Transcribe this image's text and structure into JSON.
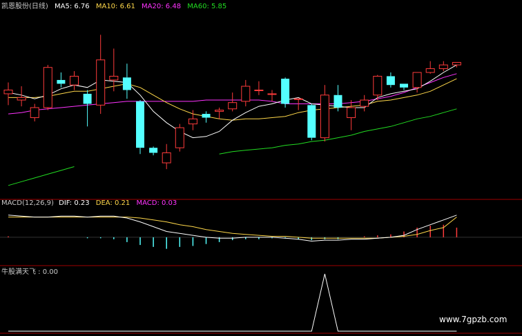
{
  "colors": {
    "up": "#ff3b3b",
    "down": "#54ffff",
    "ma5": "#ffffff",
    "ma10": "#ffd84a",
    "ma20": "#ff33ff",
    "ma60": "#22dd22",
    "dif": "#ffffff",
    "dea": "#ffd84a",
    "panel_border": "#a00000",
    "indicator": "#ffffff"
  },
  "header": {
    "stock_title": "凯恩股份(日线)",
    "ma5": "MA5: 6.76",
    "ma10": "MA10: 6.61",
    "ma20": "MA20: 6.48",
    "ma60": "MA60: 5.85"
  },
  "macd_header": {
    "title": "MACD(12,26,9)",
    "dif": "DIF: 0.23",
    "dea": "DEA: 0.21",
    "macd": "MACD: 0.03"
  },
  "indicator_header": {
    "label": "牛股满天飞 : 0.00"
  },
  "watermark": "www.7gpzb.com",
  "chart_data": [
    {
      "type": "candlestick",
      "candles": [
        {
          "o": 6.13,
          "h": 6.22,
          "l": 6.04,
          "c": 6.16
        },
        {
          "o": 6.08,
          "h": 6.19,
          "l": 6.03,
          "c": 6.1
        },
        {
          "o": 5.94,
          "h": 6.05,
          "l": 5.91,
          "c": 6.02
        },
        {
          "o": 6.02,
          "h": 6.36,
          "l": 6.0,
          "c": 6.34
        },
        {
          "o": 6.24,
          "h": 6.3,
          "l": 6.18,
          "c": 6.21
        },
        {
          "o": 6.2,
          "h": 6.31,
          "l": 6.16,
          "c": 6.27
        },
        {
          "o": 6.13,
          "h": 6.16,
          "l": 5.87,
          "c": 6.05
        },
        {
          "o": 6.04,
          "h": 6.6,
          "l": 5.97,
          "c": 6.4
        },
        {
          "o": 6.24,
          "h": 6.49,
          "l": 6.15,
          "c": 6.27
        },
        {
          "o": 6.26,
          "h": 6.37,
          "l": 6.09,
          "c": 6.16
        },
        {
          "o": 6.07,
          "h": 6.08,
          "l": 5.65,
          "c": 5.7
        },
        {
          "o": 5.7,
          "h": 5.71,
          "l": 5.64,
          "c": 5.66
        },
        {
          "o": 5.58,
          "h": 5.73,
          "l": 5.53,
          "c": 5.66
        },
        {
          "o": 5.7,
          "h": 5.89,
          "l": 5.67,
          "c": 5.86
        },
        {
          "o": 5.89,
          "h": 6.0,
          "l": 5.84,
          "c": 5.93
        },
        {
          "o": 5.97,
          "h": 5.99,
          "l": 5.9,
          "c": 5.94
        },
        {
          "o": 5.99,
          "h": 6.02,
          "l": 5.93,
          "c": 6.0
        },
        {
          "o": 6.01,
          "h": 6.14,
          "l": 5.99,
          "c": 6.06
        },
        {
          "o": 6.07,
          "h": 6.24,
          "l": 6.03,
          "c": 6.19
        },
        {
          "o": 6.16,
          "h": 6.23,
          "l": 6.12,
          "c": 6.16
        },
        {
          "o": 6.13,
          "h": 6.16,
          "l": 6.07,
          "c": 6.13
        },
        {
          "o": 6.25,
          "h": 6.26,
          "l": 6.02,
          "c": 6.05
        },
        {
          "o": 6.09,
          "h": 6.09,
          "l": 6.0,
          "c": 6.09
        },
        {
          "o": 6.04,
          "h": 6.05,
          "l": 5.76,
          "c": 5.78
        },
        {
          "o": 5.78,
          "h": 6.2,
          "l": 5.75,
          "c": 6.12
        },
        {
          "o": 6.12,
          "h": 6.2,
          "l": 5.99,
          "c": 6.02
        },
        {
          "o": 5.94,
          "h": 6.08,
          "l": 5.84,
          "c": 6.02
        },
        {
          "o": 6.03,
          "h": 6.12,
          "l": 5.99,
          "c": 6.08
        },
        {
          "o": 6.12,
          "h": 6.28,
          "l": 6.08,
          "c": 6.27
        },
        {
          "o": 6.27,
          "h": 6.3,
          "l": 6.18,
          "c": 6.2
        },
        {
          "o": 6.21,
          "h": 6.21,
          "l": 6.16,
          "c": 6.18
        },
        {
          "o": 6.18,
          "h": 6.3,
          "l": 6.14,
          "c": 6.3
        },
        {
          "o": 6.3,
          "h": 6.39,
          "l": 6.29,
          "c": 6.33
        },
        {
          "o": 6.33,
          "h": 6.39,
          "l": 6.31,
          "c": 6.36
        },
        {
          "o": 6.36,
          "h": 6.38,
          "l": 6.34,
          "c": 6.38
        }
      ],
      "ma5": [
        6.14,
        6.12,
        6.09,
        6.12,
        6.17,
        6.2,
        6.18,
        6.24,
        6.23,
        6.22,
        6.12,
        5.99,
        5.9,
        5.83,
        5.78,
        5.79,
        5.83,
        5.92,
        5.98,
        6.03,
        6.05,
        6.08,
        6.1,
        6.05,
        6.04,
        6.03,
        6.02,
        6.02,
        6.1,
        6.13,
        6.15,
        6.17,
        6.23,
        6.3,
        6.36
      ],
      "ma10": [
        6.1,
        6.1,
        6.1,
        6.11,
        6.13,
        6.15,
        6.15,
        6.17,
        6.19,
        6.21,
        6.18,
        6.12,
        6.06,
        6.01,
        5.97,
        5.95,
        5.93,
        5.92,
        5.93,
        5.93,
        5.94,
        5.95,
        5.98,
        6.0,
        6.01,
        6.02,
        6.03,
        6.04,
        6.07,
        6.08,
        6.1,
        6.12,
        6.15,
        6.2,
        6.25
      ],
      "ma20": [
        5.97,
        5.98,
        6.0,
        6.01,
        6.02,
        6.03,
        6.04,
        6.05,
        6.06,
        6.07,
        6.07,
        6.07,
        6.07,
        6.07,
        6.07,
        6.08,
        6.08,
        6.08,
        6.08,
        6.08,
        6.07,
        6.05,
        6.05,
        6.05,
        6.05,
        6.05,
        6.06,
        6.07,
        6.09,
        6.11,
        6.14,
        6.18,
        6.22,
        6.26,
        6.29
      ],
      "ma60": [
        5.4,
        5.43,
        5.46,
        5.49,
        5.52,
        5.55,
        null,
        null,
        null,
        null,
        null,
        null,
        null,
        null,
        null,
        null,
        5.65,
        5.67,
        5.68,
        5.69,
        5.7,
        5.72,
        5.73,
        5.75,
        5.76,
        5.78,
        5.8,
        5.83,
        5.85,
        5.87,
        5.9,
        5.93,
        5.95,
        5.98,
        6.01
      ],
      "ylim": [
        5.3,
        6.8
      ]
    },
    {
      "type": "line",
      "title": "MACD(12,26,9)",
      "dif": [
        0.23,
        0.22,
        0.21,
        0.21,
        0.22,
        0.22,
        0.21,
        0.22,
        0.22,
        0.2,
        0.16,
        0.11,
        0.06,
        0.04,
        0.02,
        0.0,
        -0.01,
        -0.01,
        0.0,
        0.0,
        0.0,
        -0.01,
        -0.02,
        -0.04,
        -0.03,
        -0.03,
        -0.02,
        -0.02,
        -0.01,
        0.0,
        0.02,
        0.08,
        0.13,
        0.18,
        0.23
      ],
      "dea": [
        0.21,
        0.21,
        0.21,
        0.21,
        0.21,
        0.21,
        0.21,
        0.21,
        0.21,
        0.21,
        0.2,
        0.18,
        0.16,
        0.13,
        0.11,
        0.08,
        0.06,
        0.04,
        0.03,
        0.02,
        0.01,
        0.01,
        0.0,
        -0.01,
        -0.01,
        -0.01,
        -0.01,
        -0.01,
        -0.01,
        0.0,
        0.01,
        0.03,
        0.07,
        0.1,
        0.21
      ],
      "macd": [
        0.01,
        0.0,
        0.0,
        0.0,
        0.0,
        0.0,
        -0.01,
        -0.01,
        -0.02,
        -0.05,
        -0.08,
        -0.1,
        -0.12,
        -0.1,
        -0.09,
        -0.07,
        -0.05,
        -0.03,
        -0.02,
        -0.02,
        -0.01,
        -0.01,
        -0.02,
        -0.03,
        -0.02,
        -0.02,
        0.0,
        0.01,
        0.02,
        0.03,
        0.06,
        0.1,
        0.12,
        0.13,
        0.1
      ],
      "ylim": [
        -0.28,
        0.3
      ]
    },
    {
      "type": "line",
      "title": "牛股满天飞",
      "values": [
        0,
        0,
        0,
        0,
        0,
        0,
        0,
        0,
        0,
        0,
        0,
        0,
        0,
        0,
        0,
        0,
        0,
        0,
        0,
        0,
        0,
        0,
        0,
        0,
        1,
        0,
        0,
        0,
        0,
        0,
        0,
        0,
        0,
        0,
        0
      ],
      "ylim": [
        0,
        1
      ]
    }
  ]
}
